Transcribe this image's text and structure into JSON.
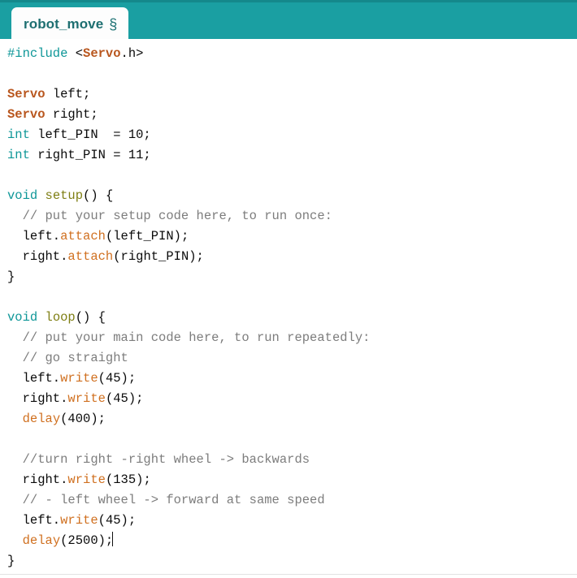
{
  "window": {
    "accent_color": "#1a9fa2",
    "accent_dark": "#14888b",
    "background": "#ffffff"
  },
  "tab": {
    "name": "robot_move",
    "modified_marker": "§"
  },
  "syntax_colors": {
    "preprocessor": "#0f9798",
    "type": "#b9571f",
    "function": "#d07020",
    "definition": "#7f7f14",
    "comment": "#7d7d7d",
    "plain": "#0a0a0a"
  },
  "editor": {
    "caret_line": 23,
    "caret_after": "delay(2500);",
    "lines": [
      {
        "n": 1,
        "tokens": [
          {
            "t": "#include ",
            "c": "pre"
          },
          {
            "t": "<",
            "c": "plain"
          },
          {
            "t": "Servo",
            "c": "type"
          },
          {
            "t": ".h>",
            "c": "plain"
          }
        ]
      },
      {
        "n": 2,
        "tokens": []
      },
      {
        "n": 3,
        "tokens": [
          {
            "t": "Servo",
            "c": "type"
          },
          {
            "t": " left;",
            "c": "plain"
          }
        ]
      },
      {
        "n": 4,
        "tokens": [
          {
            "t": "Servo",
            "c": "type"
          },
          {
            "t": " right;",
            "c": "plain"
          }
        ]
      },
      {
        "n": 5,
        "tokens": [
          {
            "t": "int",
            "c": "pre"
          },
          {
            "t": " left_PIN  = 10;",
            "c": "plain"
          }
        ]
      },
      {
        "n": 6,
        "tokens": [
          {
            "t": "int",
            "c": "pre"
          },
          {
            "t": " right_PIN = 11;",
            "c": "plain"
          }
        ]
      },
      {
        "n": 7,
        "tokens": []
      },
      {
        "n": 8,
        "tokens": [
          {
            "t": "void",
            "c": "pre"
          },
          {
            "t": " ",
            "c": "plain"
          },
          {
            "t": "setup",
            "c": "def"
          },
          {
            "t": "() {",
            "c": "plain"
          }
        ]
      },
      {
        "n": 9,
        "tokens": [
          {
            "t": "  // put your setup code here, to run once:",
            "c": "cmt"
          }
        ]
      },
      {
        "n": 10,
        "tokens": [
          {
            "t": "  left.",
            "c": "plain"
          },
          {
            "t": "attach",
            "c": "fn"
          },
          {
            "t": "(left_PIN);",
            "c": "plain"
          }
        ]
      },
      {
        "n": 11,
        "tokens": [
          {
            "t": "  right.",
            "c": "plain"
          },
          {
            "t": "attach",
            "c": "fn"
          },
          {
            "t": "(right_PIN);",
            "c": "plain"
          }
        ]
      },
      {
        "n": 12,
        "tokens": [
          {
            "t": "}",
            "c": "plain"
          }
        ]
      },
      {
        "n": 13,
        "tokens": []
      },
      {
        "n": 14,
        "tokens": [
          {
            "t": "void",
            "c": "pre"
          },
          {
            "t": " ",
            "c": "plain"
          },
          {
            "t": "loop",
            "c": "def"
          },
          {
            "t": "() {",
            "c": "plain"
          }
        ]
      },
      {
        "n": 15,
        "tokens": [
          {
            "t": "  // put your main code here, to run repeatedly:",
            "c": "cmt"
          }
        ]
      },
      {
        "n": 16,
        "tokens": [
          {
            "t": "  // go straight",
            "c": "cmt"
          }
        ]
      },
      {
        "n": 17,
        "tokens": [
          {
            "t": "  left.",
            "c": "plain"
          },
          {
            "t": "write",
            "c": "fn"
          },
          {
            "t": "(45);",
            "c": "plain"
          }
        ]
      },
      {
        "n": 18,
        "tokens": [
          {
            "t": "  right.",
            "c": "plain"
          },
          {
            "t": "write",
            "c": "fn"
          },
          {
            "t": "(45);",
            "c": "plain"
          }
        ]
      },
      {
        "n": 19,
        "tokens": [
          {
            "t": "  ",
            "c": "plain"
          },
          {
            "t": "delay",
            "c": "fn"
          },
          {
            "t": "(400);",
            "c": "plain"
          }
        ]
      },
      {
        "n": 20,
        "tokens": []
      },
      {
        "n": 21,
        "tokens": [
          {
            "t": "  //turn right -right wheel -> backwards",
            "c": "cmt"
          }
        ]
      },
      {
        "n": 22,
        "tokens": [
          {
            "t": "  right.",
            "c": "plain"
          },
          {
            "t": "write",
            "c": "fn"
          },
          {
            "t": "(135);",
            "c": "plain"
          }
        ]
      },
      {
        "n": 23,
        "tokens": [
          {
            "t": "  // - left wheel -> forward at same speed",
            "c": "cmt"
          }
        ]
      },
      {
        "n": 24,
        "tokens": [
          {
            "t": "  left.",
            "c": "plain"
          },
          {
            "t": "write",
            "c": "fn"
          },
          {
            "t": "(45);",
            "c": "plain"
          }
        ]
      },
      {
        "n": 25,
        "tokens": [
          {
            "t": "  ",
            "c": "plain"
          },
          {
            "t": "delay",
            "c": "fn"
          },
          {
            "t": "(2500);",
            "c": "plain"
          }
        ],
        "caret": true
      },
      {
        "n": 26,
        "tokens": [
          {
            "t": "}",
            "c": "plain"
          }
        ]
      }
    ]
  }
}
